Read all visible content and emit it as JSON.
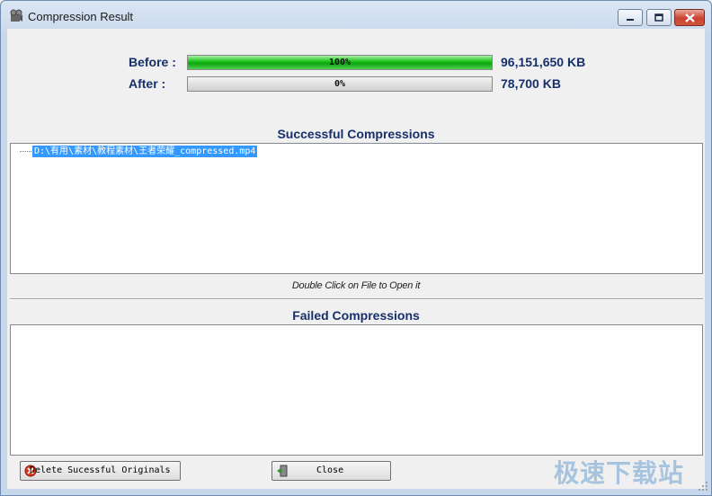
{
  "window": {
    "title": "Compression Result"
  },
  "titlebar_icons": {
    "app": "film-reel-icon",
    "minimize": "minimize-icon",
    "maximize": "maximize-icon",
    "close": "close-icon"
  },
  "stats": {
    "before": {
      "label": "Before :",
      "percent_text": "100%",
      "fill_percent": 100,
      "size": "96,151,650 KB"
    },
    "after": {
      "label": "After :",
      "percent_text": "0%",
      "fill_percent": 0,
      "size": "78,700 KB"
    }
  },
  "successful": {
    "title": "Successful Compressions",
    "items": [
      "D:\\有用\\素材\\教程素材\\王者荣耀_compressed.mp4"
    ],
    "hint": "Double Click on File to Open it"
  },
  "failed": {
    "title": "Failed Compressions",
    "items": []
  },
  "buttons": {
    "delete": {
      "label": "Delete Sucessful Originals",
      "icon": "delete-icon"
    },
    "close": {
      "label": "Close",
      "icon": "exit-door-icon"
    }
  },
  "watermark": "极速下载站",
  "colors": {
    "accent_text": "#17306b",
    "progress_fill": "#18c018",
    "selection": "#3399ff"
  }
}
